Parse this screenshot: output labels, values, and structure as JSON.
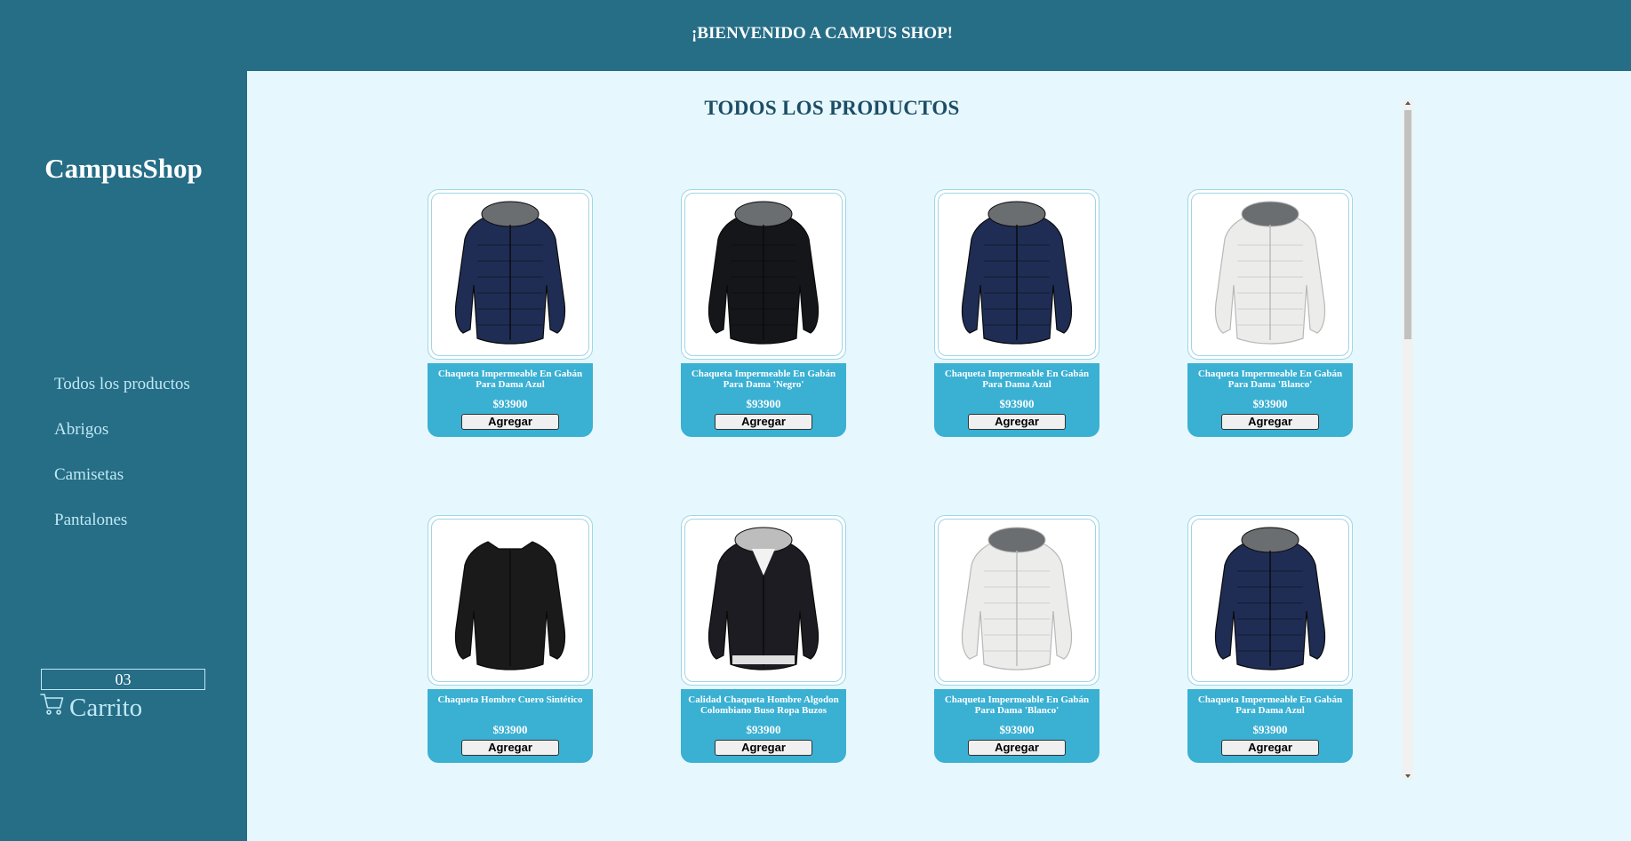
{
  "header": {
    "welcome": "¡BIENVENIDO A CAMPUS SHOP!"
  },
  "sidebar": {
    "brand": "CampusShop",
    "nav": [
      {
        "label": "Todos los productos"
      },
      {
        "label": "Abrigos"
      },
      {
        "label": "Camisetas"
      },
      {
        "label": "Pantalones"
      }
    ],
    "cart": {
      "label": "Carrito",
      "count": "03"
    }
  },
  "main": {
    "title": "TODOS LOS PRODUCTOS",
    "products": [
      {
        "title": "Chaqueta Impermeable En Gabán Para Dama Azul",
        "price": "$93900",
        "button": "Agregar",
        "image": "navy-hooded-puffer-jacket",
        "color": "#1f2d55"
      },
      {
        "title": "Chaqueta Impermeable En Gabán Para Dama 'Negro'",
        "price": "$93900",
        "button": "Agregar",
        "image": "black-hooded-puffer-jacket",
        "color": "#15161a"
      },
      {
        "title": "Chaqueta Impermeable En Gabán Para Dama Azul",
        "price": "$93900",
        "button": "Agregar",
        "image": "navy-hooded-puffer-jacket",
        "color": "#1f2d55"
      },
      {
        "title": "Chaqueta Impermeable En Gabán Para Dama 'Blanco'",
        "price": "$93900",
        "button": "Agregar",
        "image": "white-hooded-puffer-jacket",
        "color": "#ececea"
      },
      {
        "title": "Chaqueta Hombre Cuero Sintético",
        "price": "$93900",
        "button": "Agregar",
        "image": "black-leather-jacket",
        "color": "#1a1a1a"
      },
      {
        "title": "Calidad Chaqueta Hombre Algodon Colombiano Buso Ropa Buzos",
        "price": "$93900",
        "button": "Agregar",
        "image": "black-white-hooded-jacket",
        "color": "#1c1c22"
      },
      {
        "title": "Chaqueta Impermeable En Gabán Para Dama 'Blanco'",
        "price": "$93900",
        "button": "Agregar",
        "image": "white-hooded-puffer-jacket",
        "color": "#ececea"
      },
      {
        "title": "Chaqueta Impermeable En Gabán Para Dama Azul",
        "price": "$93900",
        "button": "Agregar",
        "image": "navy-hooded-puffer-jacket",
        "color": "#1f2d55"
      }
    ]
  },
  "icons": {
    "cart": "shopping-cart-icon"
  }
}
